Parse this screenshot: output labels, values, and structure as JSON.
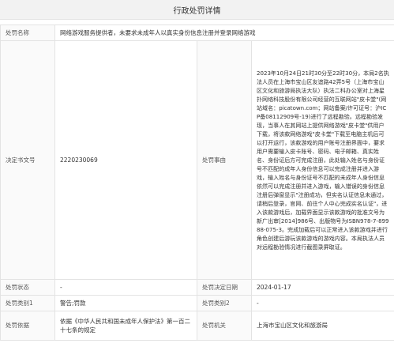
{
  "page": {
    "title": "行政处罚详情"
  },
  "labels": {
    "penalty_name": "处罚名称",
    "doc_number": "决定书文号",
    "reason": "处罚事由",
    "status": "处罚状态",
    "decision_date": "处罚决定日期",
    "category1": "处罚类别1",
    "category2": "处罚类别2",
    "basis": "处罚依据",
    "authority": "处罚机关"
  },
  "values": {
    "penalty_name": "网络游戏服务提供者，未要求未成年人以真实身份信息注册并登录网络游戏",
    "doc_number": "2220230069",
    "reason": "2023年10月24日21时30分至22时30分，本局2名执法人员在上海市宝山区友谊路42弄5号（上海市宝山区文化和旅游局执法大队）执法二科办公室对上海星扑网络科技股份有限公司经营的互联网站\"皮卡堂\"(网站域名：picatown.com；网站备案/许可证号：沪ICP备08112909号-19)进行了远程勘验。远程勘验发现，当事人在其网站上提供网络游戏\"皮卡堂\"供用户下载，将该款网络游戏\"皮卡堂\"下载至电脑主机后可以打开运行，该款游戏的用户账号注册界面中，要求用户需要输入皮卡账号、密码、电子邮箱、真实姓名、身份证后方可完成注册，此处输入姓名与身份证号不匹配的成年人身份信息可以完成注册并进入游戏，输入姓名与身份证号不匹配的未成年人身份信息依然可以完成注册并进入游戏，输入错误的身份信息注册后弹窗显示\"注册成功，但实名认证信息未通过，请稍后登录，官网、前往个人中心完成实名认证\"，进入该款游戏后，加载界面显示该款游戏的批准文号为新广出审[2014]986号、出版物号为ISBN978-7-89988-075-3。完成加载后可以正常进入该款游戏并进行角色创建后游玩该款游戏的游戏内容。本局执法人员对远程勘验情况进行截图录屏取证。",
    "status": "-",
    "decision_date": "2024-01-17",
    "category1": "警告;罚款",
    "category2": "-",
    "basis": "依据《中华人民共和国未成年人保护法》第一百二十七条的规定",
    "authority": "上海市宝山区文化和旅游局"
  }
}
